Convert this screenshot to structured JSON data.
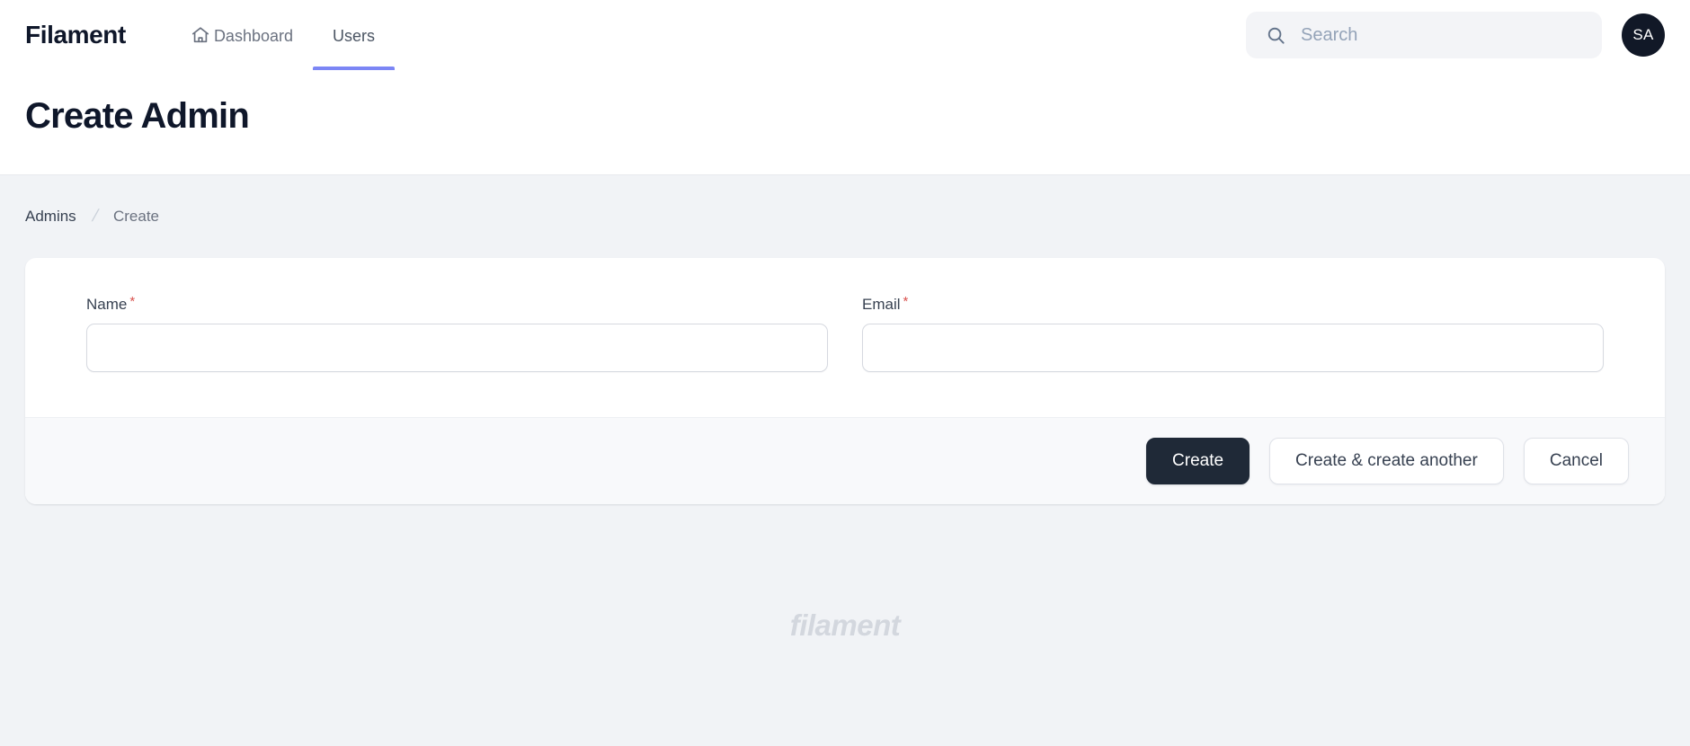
{
  "brand": {
    "name": "Filament"
  },
  "nav": {
    "items": [
      {
        "label": "Dashboard",
        "icon": "home-icon",
        "active": false
      },
      {
        "label": "Users",
        "icon": "",
        "active": true
      }
    ],
    "active_underline_color": "#7c86f5"
  },
  "search": {
    "placeholder": "Search",
    "value": "",
    "icon": "search-icon"
  },
  "user": {
    "avatar_initials": "SA",
    "avatar_bg": "#111827"
  },
  "page": {
    "title": "Create Admin"
  },
  "breadcrumb": {
    "parent": "Admins",
    "separator": "/",
    "current": "Create"
  },
  "form": {
    "fields": [
      {
        "label": "Name",
        "required_mark": "*",
        "value": "",
        "placeholder": ""
      },
      {
        "label": "Email",
        "required_mark": "*",
        "value": "",
        "placeholder": ""
      }
    ]
  },
  "actions": {
    "create": "Create",
    "create_another": "Create & create another",
    "cancel": "Cancel"
  },
  "footer": {
    "logo_text": "filament",
    "logo_color": "#d3d7de"
  }
}
